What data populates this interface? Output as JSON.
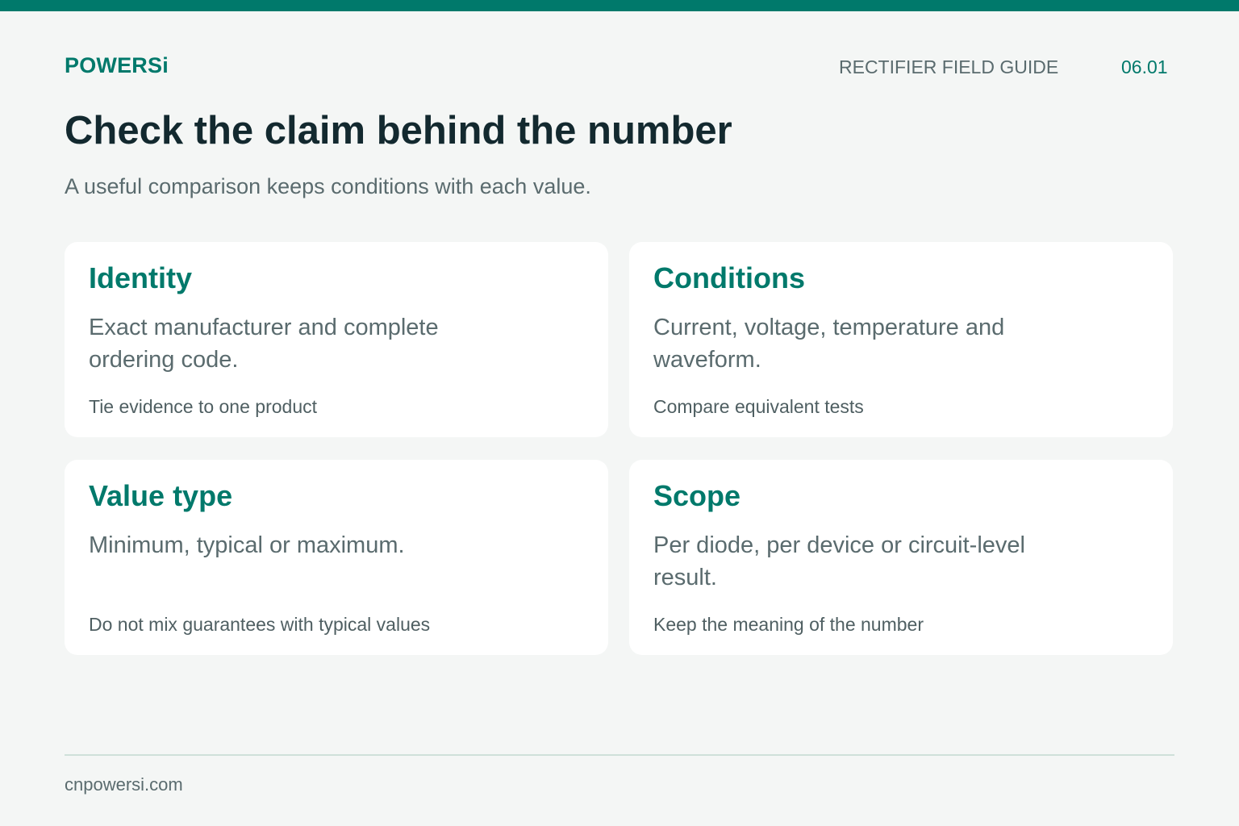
{
  "header": {
    "brand": "POWERSi",
    "guide_label": "RECTIFIER FIELD GUIDE",
    "page_number": "06.01"
  },
  "title": "Check the claim behind the number",
  "subtitle": "A useful comparison keeps conditions with each value.",
  "cards": [
    {
      "title": "Identity",
      "body": "Exact manufacturer and complete ordering code.",
      "note": "Tie evidence to one product"
    },
    {
      "title": "Conditions",
      "body": "Current, voltage, temperature and waveform.",
      "note": "Compare equivalent tests"
    },
    {
      "title": "Value type",
      "body": "Minimum, typical or maximum.",
      "note": "Do not mix guarantees with typical values"
    },
    {
      "title": "Scope",
      "body": "Per diode, per device or circuit-level result.",
      "note": "Keep the meaning of the number"
    }
  ],
  "footer": {
    "url": "cnpowersi.com"
  },
  "colors": {
    "accent": "#00796b",
    "background": "#f4f6f5",
    "title": "#13292f",
    "muted_text": "#5a6b6e",
    "card": "#ffffff",
    "divider": "#cfe0d9"
  }
}
